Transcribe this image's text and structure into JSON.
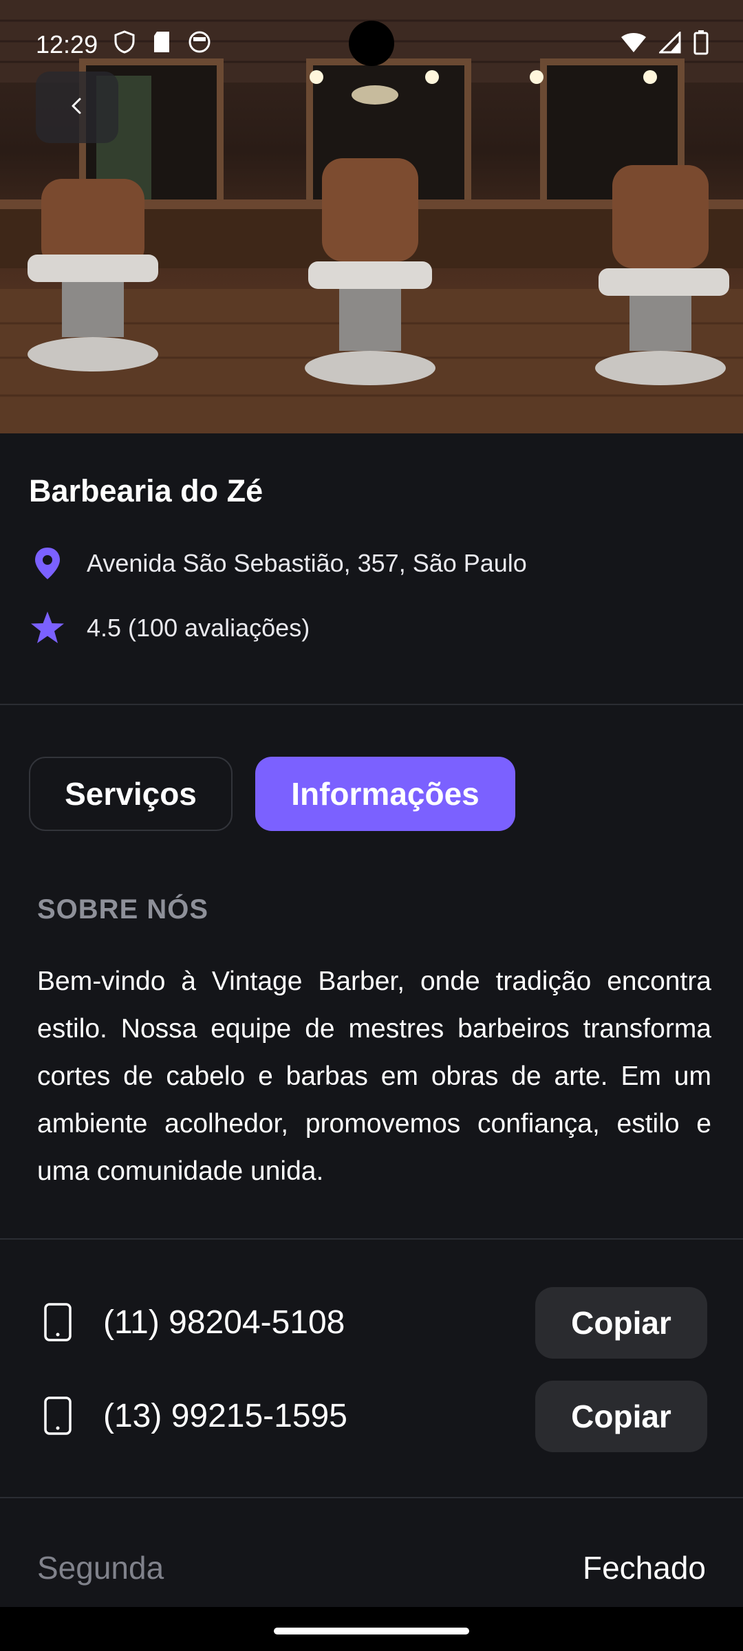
{
  "status_bar": {
    "time": "12:29"
  },
  "shop": {
    "name": "Barbearia do Zé",
    "address": "Avenida São Sebastião, 357, São Paulo",
    "rating": "4.5 (100 avaliações)"
  },
  "tabs": [
    {
      "label": "Serviços",
      "active": false
    },
    {
      "label": "Informações",
      "active": true
    }
  ],
  "about": {
    "heading": "SOBRE NÓS",
    "text": "Bem-vindo à Vintage Barber, onde tradição encontra estilo. Nossa equipe de mestres barbeiros transforma cortes de cabelo e barbas em obras de arte. Em um ambiente acolhedor, promovemos confiança, estilo e uma comunidade unida."
  },
  "phones": [
    {
      "number": "(11) 98204-5108",
      "copy_label": "Copiar"
    },
    {
      "number": "(13) 99215-1595",
      "copy_label": "Copiar"
    }
  ],
  "hours": [
    {
      "day": "Segunda",
      "value": "Fechado"
    }
  ],
  "colors": {
    "accent": "#7b61ff",
    "background": "#141519",
    "button_dark": "#2a2b2f",
    "muted_text": "#8e9099"
  },
  "icons": {
    "back": "chevron-left-icon",
    "location": "map-pin-icon",
    "rating": "star-icon",
    "phone": "smartphone-icon"
  }
}
